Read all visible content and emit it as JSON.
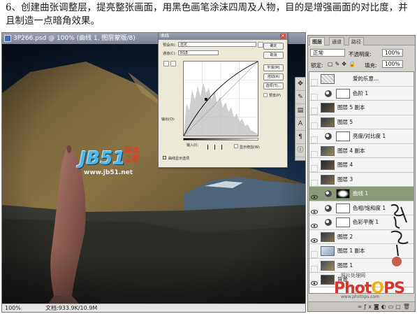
{
  "caption": "6、创建曲张调整层，提亮整张画面，用黑色画笔涂沫四周及人物，目的是增强画面的对比度，并且制造一点暗角效果。",
  "document": {
    "title": "3P266.psd @ 100% (曲线 1, 图层蒙版/8)",
    "zoom": "100%",
    "doc_size": "文档:933.9K/10.9M"
  },
  "curves_dialog": {
    "title": "曲线",
    "preset_label": "预设(R):",
    "preset_value": "自定",
    "channel_label": "通道(C):",
    "channel_value": "RGB",
    "output_label": "输出(O):",
    "input_label": "输入(I):",
    "clipping_label": "显示修剪(W)",
    "curve_display_label": "曲线显示选项",
    "buttons": [
      "确定",
      "取消",
      "平滑(M)",
      "自动(A)",
      "选项(T)..."
    ],
    "preview_label": "预览(P)"
  },
  "layers_panel": {
    "tabs": [
      "图层",
      "通道",
      "路径"
    ],
    "blend_mode": "正常",
    "opacity_label": "不透明度:",
    "opacity_value": "100%",
    "lock_label": "锁定:",
    "fill_label": "填充:",
    "fill_value": "100%",
    "layers": [
      {
        "name": "爱的乐意...",
        "kind": "texture",
        "visible": false
      },
      {
        "name": "色阶 1",
        "kind": "adjustment",
        "visible": false
      },
      {
        "name": "图层 5 副本",
        "kind": "image",
        "visible": false
      },
      {
        "name": "图层 5",
        "kind": "image",
        "visible": false
      },
      {
        "name": "亮度/对比度 1",
        "kind": "adjustment",
        "visible": false
      },
      {
        "name": "图层 4 副本",
        "kind": "image",
        "visible": false
      },
      {
        "name": "图层 4",
        "kind": "image",
        "visible": false
      },
      {
        "name": "图层 3",
        "kind": "image",
        "visible": false
      },
      {
        "name": "曲线 1",
        "kind": "adjustment",
        "visible": true
      },
      {
        "name": "色相/饱和度 1",
        "kind": "adjustment",
        "visible": true
      },
      {
        "name": "色彩平衡 1",
        "kind": "adjustment",
        "visible": true
      },
      {
        "name": "图层 2",
        "kind": "image",
        "visible": true
      },
      {
        "name": "图层 1 副本",
        "kind": "image",
        "visible": false
      },
      {
        "name": "图层 1",
        "kind": "image",
        "visible": false
      },
      {
        "name": "背景",
        "kind": "image",
        "visible": true
      }
    ],
    "active_layer": "曲线 1"
  },
  "watermarks": {
    "jb51": "JB51",
    "jiaoben_top": "脚本",
    "jiaoben_bottom": "之家",
    "jb51_url": "www.jb51.net",
    "photops_cn": "照片处理网",
    "photops_left": "Phot",
    "photops_o": "O",
    "photops_right": "PS",
    "photops_url": "www.photops.com"
  }
}
